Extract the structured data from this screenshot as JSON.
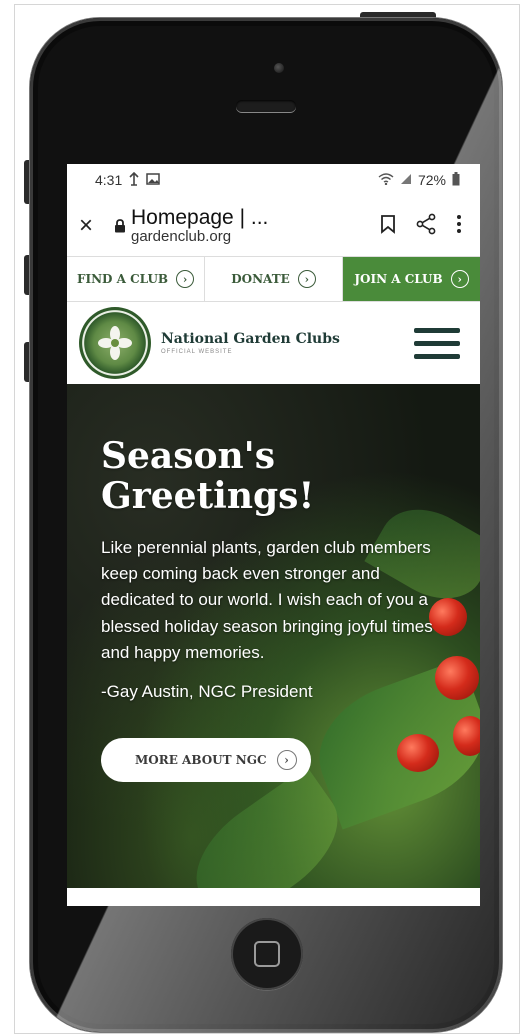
{
  "status_bar": {
    "time": "4:31",
    "battery": "72%",
    "icons": [
      "signal-icon",
      "image-icon",
      "wifi-icon",
      "cell-signal-icon",
      "battery-icon"
    ]
  },
  "browser": {
    "close_icon": "×",
    "page_title": "Homepage | ...",
    "domain": "gardenclub.org"
  },
  "cta_bar": {
    "find": "FIND A CLUB",
    "donate": "DONATE",
    "join": "JOIN A CLUB",
    "arrow": "›"
  },
  "header": {
    "brand": "National Garden Clubs",
    "tagline": "OFFICIAL WEBSITE"
  },
  "hero": {
    "title_line1": "Season's",
    "title_line2": "Greetings!",
    "body": "Like perennial plants, garden club members keep coming back even stronger and dedicated to our world. I wish each of you a blessed holiday season bringing joyful times and happy memories.",
    "signature": "-Gay Austin, NGC President",
    "button": "MORE ABOUT NGC",
    "arrow": "›"
  },
  "colors": {
    "accent_green": "#4a8b3a",
    "brand_dark": "#1f3b36"
  }
}
